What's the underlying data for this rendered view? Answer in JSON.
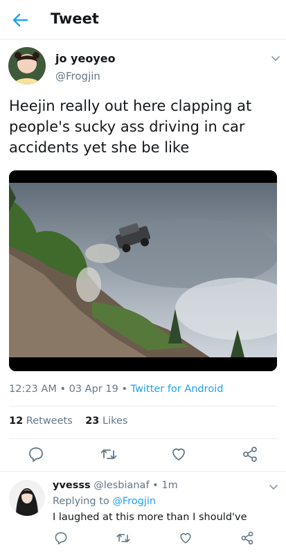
{
  "header": {
    "title": "Tweet"
  },
  "tweet": {
    "author_name": "jo yeoyeo",
    "author_handle": "@Frogjin",
    "text": "Heejin really out here clapping at people's sucky ass driving in car accidents yet she be like",
    "time": "12:23 AM",
    "date": "03 Apr 19",
    "source": "Twitter for Android",
    "retweets_count": "12",
    "retweets_label": "Retweets",
    "likes_count": "23",
    "likes_label": "Likes"
  },
  "reply": {
    "name": "yvesss",
    "handle": "@lesbianaf",
    "time": "1m",
    "replying_prefix": "Replying to",
    "replying_to": "@Frogjin",
    "text": "I laughed at this more than I should've"
  },
  "colors": {
    "accent": "#1da1f2",
    "muted": "#657786",
    "divider": "#e6ecf0"
  },
  "icons": [
    "back-arrow-icon",
    "chevron-down-icon",
    "reply-icon",
    "retweet-icon",
    "like-icon",
    "share-icon"
  ]
}
